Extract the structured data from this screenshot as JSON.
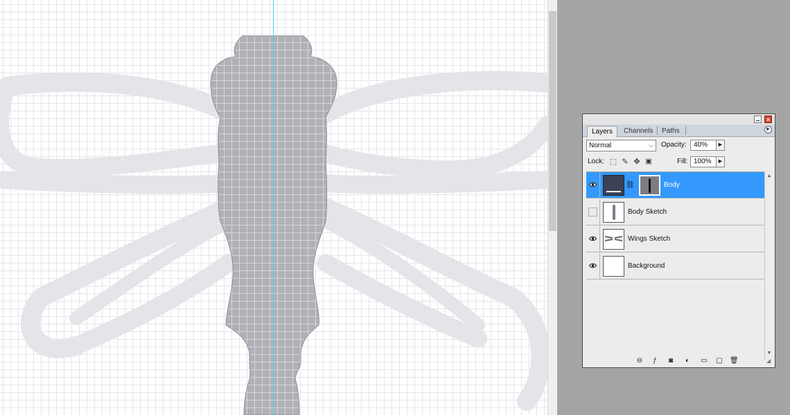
{
  "layers_panel": {
    "tabs": [
      {
        "label": "Layers"
      },
      {
        "label": "Channels"
      },
      {
        "label": "Paths"
      }
    ],
    "blend_mode": "Normal",
    "opacity_label": "Opacity:",
    "opacity_value": "40%",
    "lock_label": "Lock:",
    "fill_label": "Fill:",
    "fill_value": "100%",
    "layers": [
      {
        "name": "Body",
        "visible": true,
        "selected": true
      },
      {
        "name": "Body Sketch",
        "visible": false,
        "selected": false
      },
      {
        "name": "Wings Sketch",
        "visible": true,
        "selected": false
      },
      {
        "name": "Background",
        "visible": true,
        "selected": false
      }
    ],
    "colors": {
      "selection": "#3399ff",
      "body_fill": "#3b4257"
    }
  },
  "canvas": {
    "guide_color": "#4fd8ec",
    "shape_fill": "#afb1b6",
    "wing_sketch_color": "#e3e5e8"
  }
}
